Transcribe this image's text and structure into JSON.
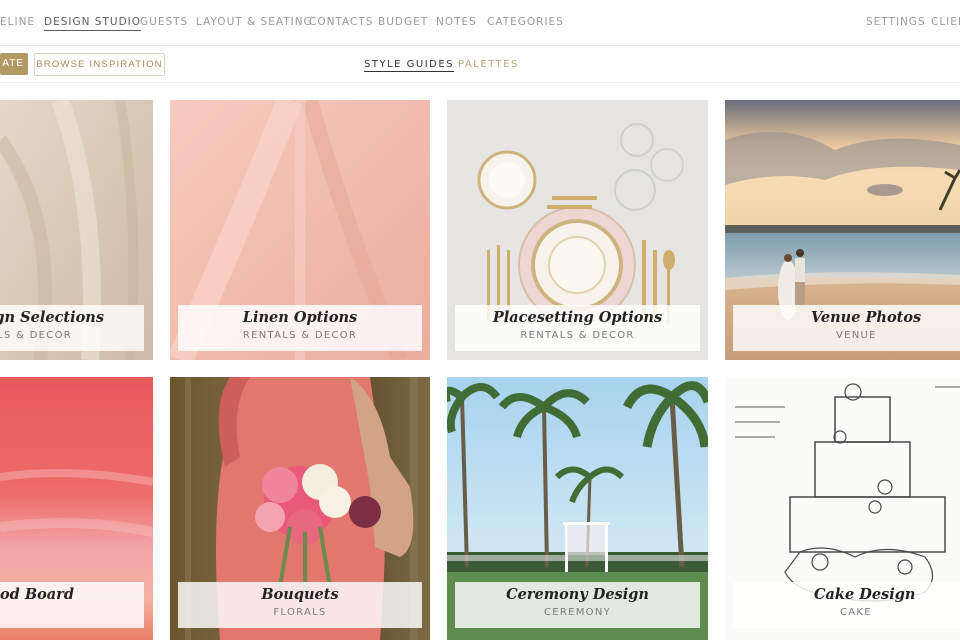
{
  "nav": {
    "items": [
      "ELINE",
      "DESIGN STUDIO",
      "GUESTS",
      "LAYOUT & SEATING",
      "CONTACTS",
      "BUDGET",
      "NOTES",
      "CATEGORIES"
    ],
    "right": [
      "SETTINGS",
      "CLIEN"
    ],
    "active": "DESIGN STUDIO"
  },
  "toolbar": {
    "create_label": "ATE",
    "browse_label": "BROWSE INSPIRATION",
    "tabs": [
      "STYLE GUIDES",
      "PALETTES"
    ],
    "active_tab": "STYLE GUIDES"
  },
  "cards": [
    {
      "title": "Design Selections",
      "shown_title": "sign Selections",
      "category": "RENTALS & DECOR",
      "shown_category": "TALS & DECOR",
      "image": "linen-fabric-beige"
    },
    {
      "title": "Linen Options",
      "category": "RENTALS & DECOR",
      "image": "linen-fabric-pink"
    },
    {
      "title": "Placesetting Options",
      "category": "RENTALS & DECOR",
      "image": "gold-place-setting"
    },
    {
      "title": "Venue Photos",
      "category": "VENUE",
      "image": "beach-sunset-couple"
    },
    {
      "title": "Mood Board",
      "shown_title": "od Board",
      "category": "",
      "image": "watercolor-coral"
    },
    {
      "title": "Bouquets",
      "category": "FLORALS",
      "image": "bridesmaid-peony-bouquet"
    },
    {
      "title": "Ceremony Design",
      "category": "CEREMONY",
      "image": "palm-trees-ceremony-arch"
    },
    {
      "title": "Cake Design",
      "category": "CAKE",
      "image": "cake-sketch"
    }
  ],
  "colors": {
    "accent_gold": "#b29964",
    "nav_text": "#9a9a9a",
    "nav_active": "#5a5a5a"
  }
}
